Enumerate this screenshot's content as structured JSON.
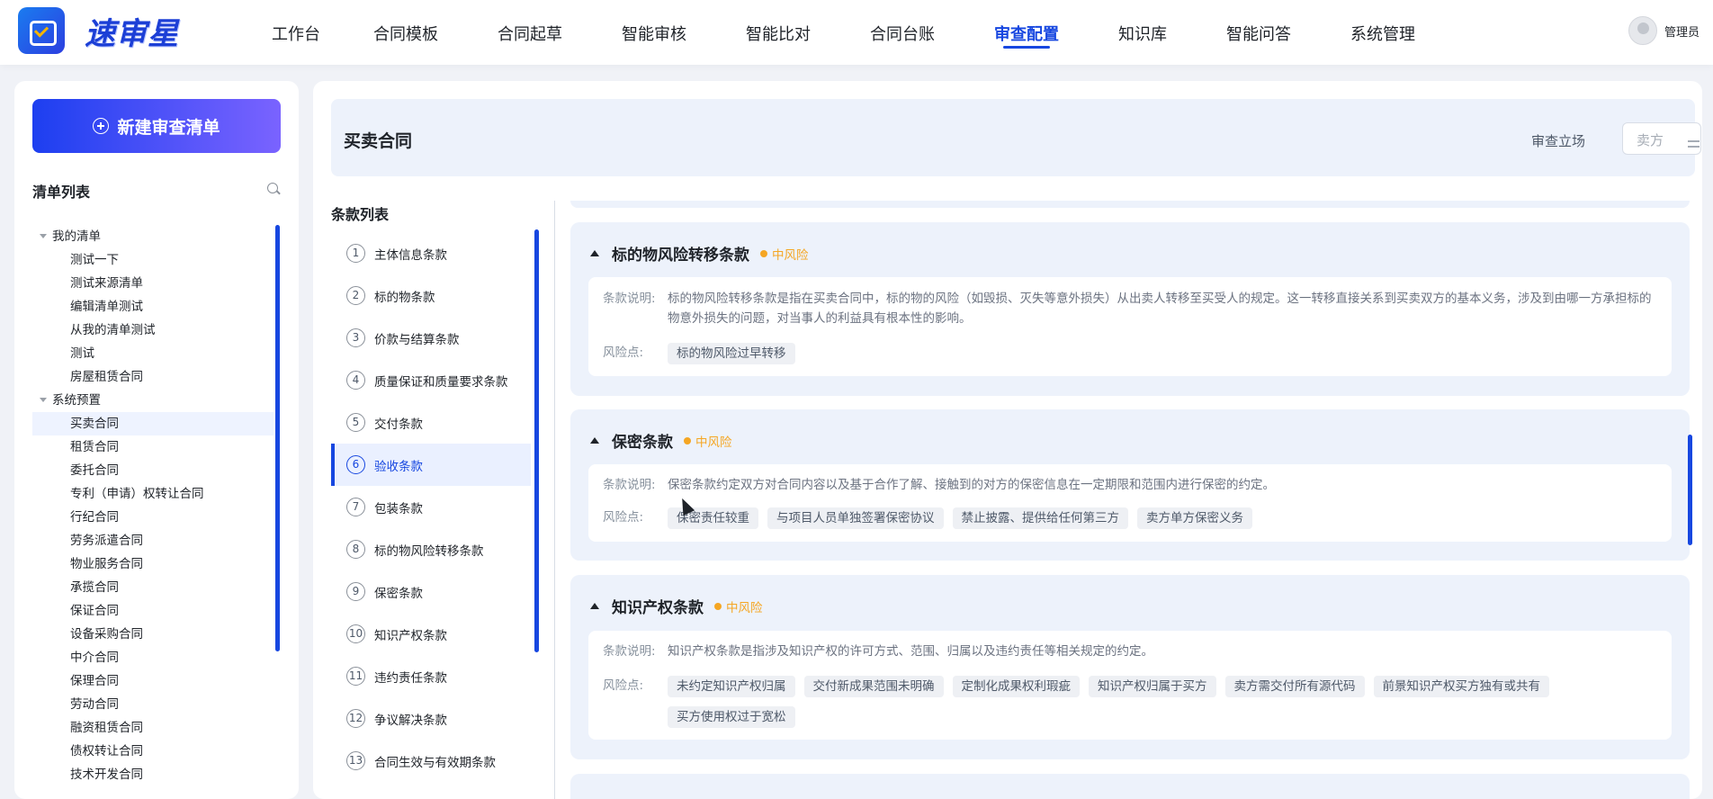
{
  "app": {
    "brand": "速审星",
    "user": "管理员"
  },
  "nav": [
    {
      "label": "工作台",
      "active": false
    },
    {
      "label": "合同模板",
      "active": false
    },
    {
      "label": "合同起草",
      "active": false
    },
    {
      "label": "智能审核",
      "active": false
    },
    {
      "label": "智能比对",
      "active": false
    },
    {
      "label": "合同台账",
      "active": false
    },
    {
      "label": "审查配置",
      "active": true
    },
    {
      "label": "知识库",
      "active": false
    },
    {
      "label": "智能问答",
      "active": false
    },
    {
      "label": "系统管理",
      "active": false
    }
  ],
  "sidebar": {
    "new_button": "新建审查清单",
    "list_title": "清单列表",
    "groups": [
      {
        "label": "我的清单",
        "items": [
          "测试一下",
          "测试来源清单",
          "编辑清单测试",
          "从我的清单测试",
          "测试",
          "房屋租赁合同"
        ]
      },
      {
        "label": "系统预置",
        "items": [
          "买卖合同",
          "租赁合同",
          "委托合同",
          "专利（申请）权转让合同",
          "行纪合同",
          "劳务派遣合同",
          "物业服务合同",
          "承揽合同",
          "保证合同",
          "设备采购合同",
          "中介合同",
          "保理合同",
          "劳动合同",
          "融资租赁合同",
          "债权转让合同",
          "技术开发合同"
        ]
      }
    ],
    "selected_item": "买卖合同"
  },
  "header": {
    "title": "买卖合同",
    "stance_label": "审查立场",
    "stance_value": "卖方"
  },
  "clauses": {
    "title": "条款列表",
    "items": [
      {
        "num": "1",
        "label": "主体信息条款"
      },
      {
        "num": "2",
        "label": "标的物条款"
      },
      {
        "num": "3",
        "label": "价款与结算条款"
      },
      {
        "num": "4",
        "label": "质量保证和质量要求条款"
      },
      {
        "num": "5",
        "label": "交付条款"
      },
      {
        "num": "6",
        "label": "验收条款"
      },
      {
        "num": "7",
        "label": "包装条款"
      },
      {
        "num": "8",
        "label": "标的物风险转移条款"
      },
      {
        "num": "9",
        "label": "保密条款"
      },
      {
        "num": "10",
        "label": "知识产权条款"
      },
      {
        "num": "11",
        "label": "违约责任条款"
      },
      {
        "num": "12",
        "label": "争议解决条款"
      },
      {
        "num": "13",
        "label": "合同生效与有效期条款"
      }
    ],
    "active_num": "6"
  },
  "labels": {
    "desc": "条款说明:",
    "risk_points": "风险点:"
  },
  "cards": [
    {
      "name": "标的物风险转移条款",
      "risk": "中风险",
      "description": "标的物风险转移条款是指在买卖合同中，标的物的风险（如毁损、灭失等意外损失）从出卖人转移至买受人的规定。这一转移直接关系到买卖双方的基本义务，涉及到由哪一方承担标的物意外损失的问题，对当事人的利益具有根本性的影响。",
      "risks": [
        "标的物风险过早转移"
      ]
    },
    {
      "name": "保密条款",
      "risk": "中风险",
      "description": "保密条款约定双方对合同内容以及基于合作了解、接触到的对方的保密信息在一定期限和范围内进行保密的约定。",
      "risks": [
        "保密责任较重",
        "与项目人员单独签署保密协议",
        "禁止披露、提供给任何第三方",
        "卖方单方保密义务"
      ]
    },
    {
      "name": "知识产权条款",
      "risk": "中风险",
      "description": "知识产权条款是指涉及知识产权的许可方式、范围、归属以及违约责任等相关规定的约定。",
      "risks": [
        "未约定知识产权归属",
        "交付新成果范围未明确",
        "定制化成果权利瑕疵",
        "知识产权归属于买方",
        "卖方需交付所有源代码",
        "前景知识产权买方独有或共有",
        "买方使用权过于宽松"
      ]
    }
  ]
}
